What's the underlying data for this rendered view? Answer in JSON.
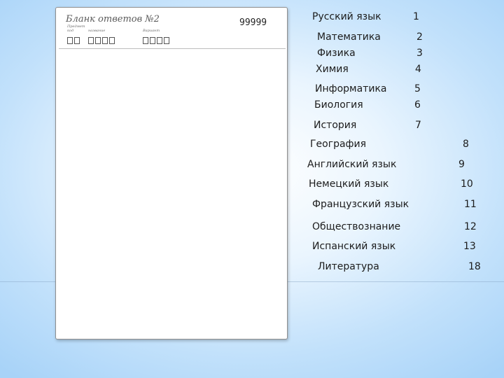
{
  "form": {
    "title": "Бланк ответов №2",
    "code": "99999",
    "fields": [
      {
        "label": "Предмет\nкод",
        "box_count": 2
      },
      {
        "label": "название",
        "box_count": 4
      },
      {
        "label": "Вариант",
        "box_count": 4
      }
    ]
  },
  "subjects": [
    {
      "name": "Русский язык",
      "code": "1"
    },
    {
      "name": "Математика",
      "code": "2"
    },
    {
      "name": "Физика",
      "code": "3"
    },
    {
      "name": "Химия",
      "code": "4"
    },
    {
      "name": "Информатика",
      "code": "5"
    },
    {
      "name": "Биология",
      "code": "6"
    },
    {
      "name": "История",
      "code": "7"
    },
    {
      "name": "География",
      "code": "8"
    },
    {
      "name": "Английский язык",
      "code": "9"
    },
    {
      "name": "Немецкий язык",
      "code": "10"
    },
    {
      "name": "Французский язык",
      "code": "11"
    },
    {
      "name": "Обществознание",
      "code": "12"
    },
    {
      "name": "Испанский язык",
      "code": "13"
    },
    {
      "name": "Литература",
      "code": "18"
    }
  ]
}
